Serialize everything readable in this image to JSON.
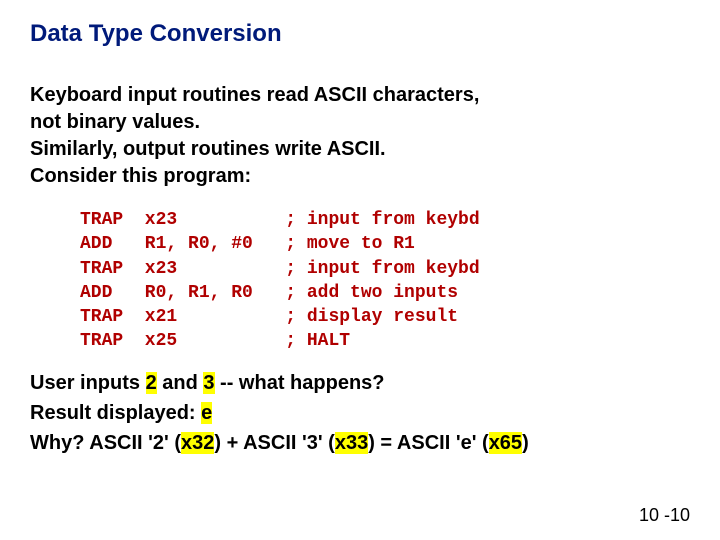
{
  "title": "Data Type Conversion",
  "para_lines": [
    "Keyboard input routines read ASCII characters,",
    "not binary values.",
    "Similarly, output routines write ASCII.",
    "Consider this program:"
  ],
  "code": [
    {
      "op": "TRAP",
      "args": "x23",
      "comment": "; input from keybd"
    },
    {
      "op": "ADD",
      "args": "R1, R0, #0",
      "comment": "; move to R1"
    },
    {
      "op": "TRAP",
      "args": "x23",
      "comment": "; input from keybd"
    },
    {
      "op": "ADD",
      "args": "R0, R1, R0",
      "comment": "; add two inputs"
    },
    {
      "op": "TRAP",
      "args": "x21",
      "comment": "; display result"
    },
    {
      "op": "TRAP",
      "args": "x25",
      "comment": "; HALT"
    }
  ],
  "followup": {
    "q_pre": "User inputs ",
    "q_hl1": "2",
    "q_mid": " and ",
    "q_hl2": "3",
    "q_post": " -- what happens?",
    "r_pre": "Result displayed: ",
    "r_hl": "e",
    "why_pre": "Why?  ASCII '2' (",
    "why_hl1": "x32",
    "why_mid1": ") + ASCII '3' (",
    "why_hl2": "x33",
    "why_mid2": ") = ASCII 'e' (",
    "why_hl3": "x65",
    "why_post": ")"
  },
  "pagenum": "10 -10"
}
